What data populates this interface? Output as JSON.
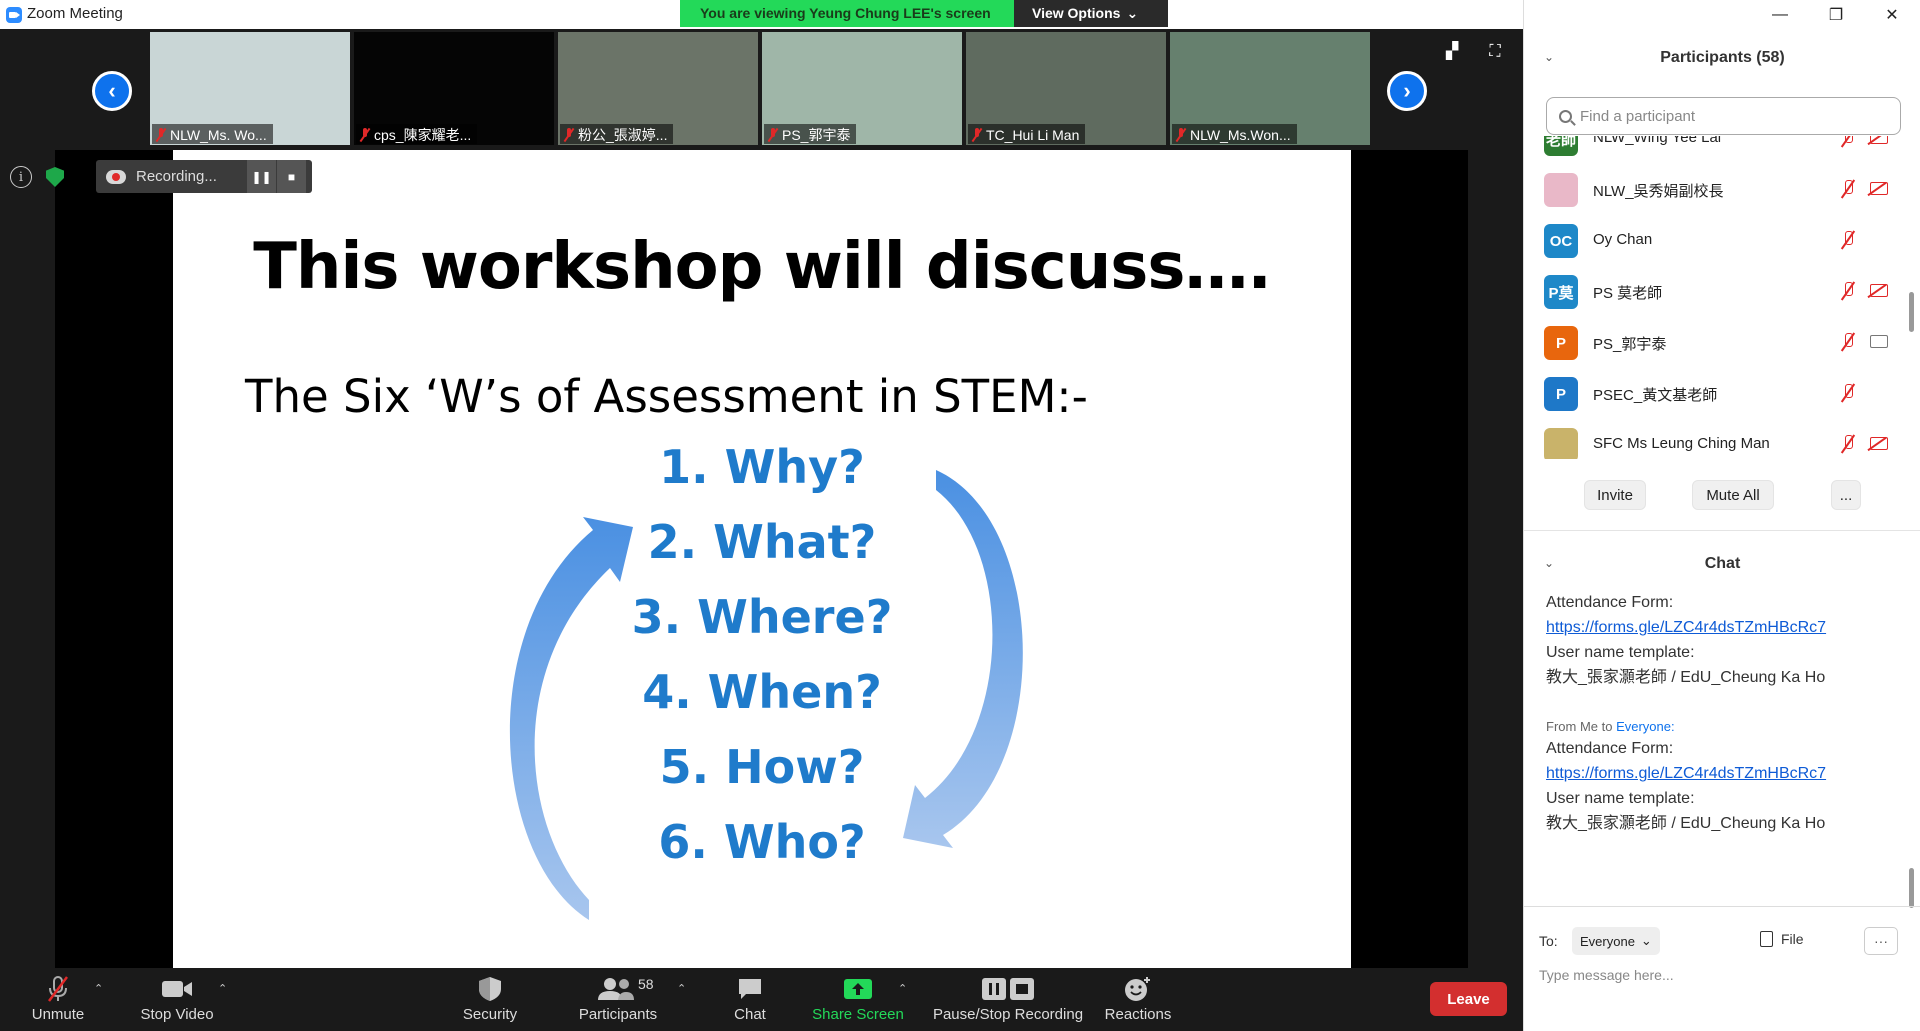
{
  "window": {
    "title": "Zoom Meeting"
  },
  "banner": {
    "viewing": "You are viewing Yeung Chung LEE's screen",
    "view_options": "View Options"
  },
  "thumbnails": [
    {
      "name": "NLW_Ms. Wo...",
      "bg": "#c9d6d6"
    },
    {
      "name": "cps_陳家耀老...",
      "bg": "#050505"
    },
    {
      "name": "粉公_張淑婷...",
      "bg": "#6b7468"
    },
    {
      "name": "PS_郭宇泰",
      "bg": "#9fb6a8"
    },
    {
      "name": "TC_Hui Li Man",
      "bg": "#5f6b5f"
    },
    {
      "name": "NLW_Ms.Won...",
      "bg": "#66806e"
    }
  ],
  "recording": {
    "label": "Recording...",
    "pause": "❚❚",
    "stop": "■"
  },
  "slide": {
    "title": "This workshop will discuss….",
    "subtitle": "The Six ‘W’s of Assessment in STEM:-",
    "items": [
      "1.  Why?",
      "2.  What?",
      "3.  Where?",
      "4.  When?",
      "5.  How?",
      "6.  Who?"
    ],
    "item_color": "#1f7bcb"
  },
  "toolbar": {
    "unmute": "Unmute",
    "stop_video": "Stop Video",
    "security": "Security",
    "participants": "Participants",
    "participants_count": "58",
    "chat": "Chat",
    "share_screen": "Share Screen",
    "pause_stop_recording": "Pause/Stop Recording",
    "reactions": "Reactions",
    "leave": "Leave"
  },
  "panel": {
    "participants_header": "Participants (58)",
    "find_placeholder": "Find a participant",
    "participants": [
      {
        "name": "NLW_Wing Yee Lai",
        "avatar": "老師",
        "color": "#2e7d32",
        "camera": "off"
      },
      {
        "name": "NLW_吳秀娟副校長",
        "avatar": "",
        "color": "#e9b8c8",
        "camera": "off"
      },
      {
        "name": "Oy Chan",
        "avatar": "OC",
        "color": "#1e88c8",
        "camera": "none"
      },
      {
        "name": "PS 莫老師",
        "avatar": "P莫",
        "color": "#1e88c8",
        "camera": "off"
      },
      {
        "name": "PS_郭宇泰",
        "avatar": "P",
        "color": "#e8660d",
        "camera": "on"
      },
      {
        "name": "PSEC_黃文基老師",
        "avatar": "P",
        "color": "#1e78c8",
        "camera": "none"
      },
      {
        "name": "SFC Ms Leung Ching Man",
        "avatar": "",
        "color": "#c9b36a",
        "camera": "off"
      }
    ],
    "invite": "Invite",
    "mute_all": "Mute All",
    "more": "...",
    "chat_header": "Chat",
    "messages": [
      {
        "from": "",
        "to": "",
        "line1": "Attendance Form:",
        "link": "https://forms.gle/LZC4r4dsTZmHBcRc7",
        "line2": "User name template:",
        "line3": "教大_張家灝老師  / EdU_Cheung Ka Ho"
      },
      {
        "from": "From Me to ",
        "to": "Everyone:",
        "line1": "Attendance Form:",
        "link": "https://forms.gle/LZC4r4dsTZmHBcRc7",
        "line2": "User name template:",
        "line3": "教大_張家灝老師  / EdU_Cheung Ka Ho"
      }
    ],
    "to_label": "To:",
    "to_value": "Everyone",
    "file": "File",
    "message_placeholder": "Type message here..."
  }
}
